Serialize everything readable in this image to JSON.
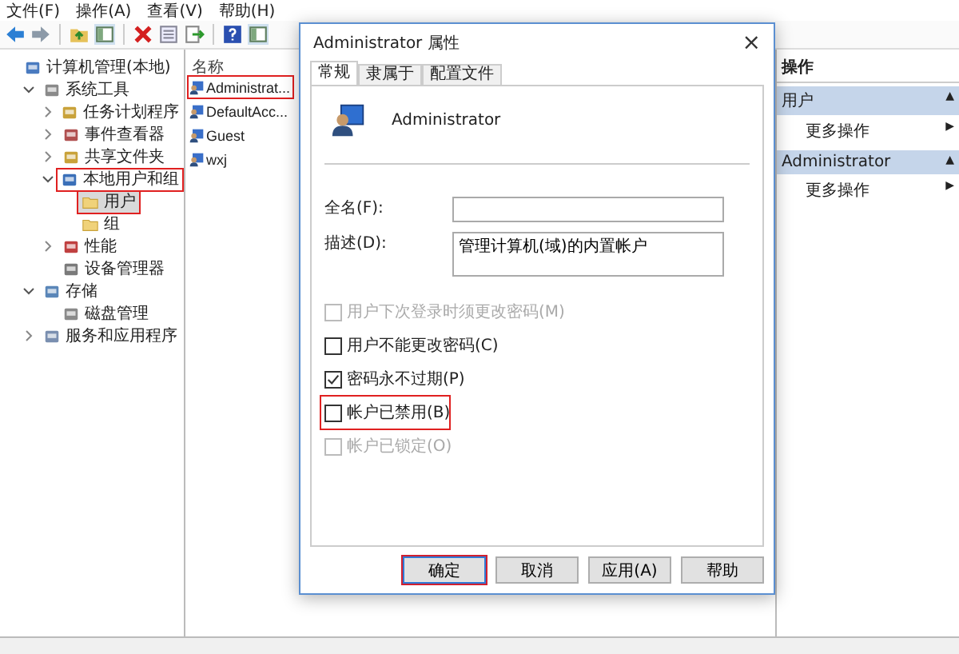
{
  "menu": [
    "文件(F)",
    "操作(A)",
    "查看(V)",
    "帮助(H)"
  ],
  "toolbar": [
    {
      "kind": "back"
    },
    {
      "kind": "forward"
    },
    {
      "kind": "sep"
    },
    {
      "kind": "up"
    },
    {
      "kind": "pane"
    },
    {
      "kind": "sep"
    },
    {
      "kind": "delete"
    },
    {
      "kind": "props"
    },
    {
      "kind": "export"
    },
    {
      "kind": "sep"
    },
    {
      "kind": "help"
    },
    {
      "kind": "pane"
    }
  ],
  "tree": [
    {
      "label": "计算机管理(本地)",
      "kind": "computer",
      "selected": false,
      "highlighted": false,
      "children": [
        {
          "label": "系统工具",
          "kind": "tool",
          "expanded": true,
          "selected": false,
          "highlighted": false,
          "children": [
            {
              "label": "任务计划程序",
              "kind": "clock",
              "expanded": false,
              "selected": false,
              "highlighted": false
            },
            {
              "label": "事件查看器",
              "kind": "log",
              "expanded": false,
              "selected": false,
              "highlighted": false
            },
            {
              "label": "共享文件夹",
              "kind": "share",
              "expanded": false,
              "selected": false,
              "highlighted": false
            },
            {
              "label": "本地用户和组",
              "kind": "users",
              "expanded": true,
              "selected": false,
              "highlighted": true,
              "children": [
                {
                  "label": "用户",
                  "kind": "folder",
                  "selected": true,
                  "highlighted": true
                },
                {
                  "label": "组",
                  "kind": "folder",
                  "selected": false,
                  "highlighted": false
                }
              ]
            },
            {
              "label": "性能",
              "kind": "perf",
              "expanded": false,
              "selected": false,
              "highlighted": false
            },
            {
              "label": "设备管理器",
              "kind": "device",
              "selected": false,
              "highlighted": false
            }
          ]
        },
        {
          "label": "存储",
          "kind": "storage",
          "expanded": true,
          "selected": false,
          "highlighted": false,
          "children": [
            {
              "label": "磁盘管理",
              "kind": "disk",
              "selected": false,
              "highlighted": false
            }
          ]
        },
        {
          "label": "服务和应用程序",
          "kind": "services",
          "expanded": false,
          "selected": false,
          "highlighted": false
        }
      ]
    }
  ],
  "list": {
    "header": "名称",
    "items": [
      {
        "name": "Administrat...",
        "highlighted": true
      },
      {
        "name": "DefaultAcc...",
        "highlighted": false
      },
      {
        "name": "Guest",
        "highlighted": false
      },
      {
        "name": "wxj",
        "highlighted": false
      }
    ]
  },
  "dialog": {
    "title": "Administrator 属性",
    "close": "×",
    "tabs": [
      {
        "label": "常规",
        "selected": true
      },
      {
        "label": "隶属于",
        "selected": false
      },
      {
        "label": "配置文件",
        "selected": false
      }
    ],
    "user_name": "Administrator",
    "fields": [
      {
        "label": "全名(F):",
        "kind": "line"
      },
      {
        "label": "描述(D):",
        "value": "管理计算机(域)的内置帐户",
        "kind": "area"
      }
    ],
    "checkboxes": [
      {
        "label": "用户下次登录时须更改密码(M)",
        "checked": false,
        "disabled": true,
        "highlighted": false
      },
      {
        "label": "用户不能更改密码(C)",
        "checked": false,
        "disabled": false,
        "highlighted": false
      },
      {
        "label": "密码永不过期(P)",
        "checked": true,
        "disabled": false,
        "highlighted": false
      },
      {
        "label": "帐户已禁用(B)",
        "checked": false,
        "disabled": false,
        "highlighted": true
      },
      {
        "label": "帐户已锁定(O)",
        "checked": false,
        "disabled": true,
        "highlighted": false
      }
    ],
    "buttons": [
      {
        "label": "确定",
        "default": true,
        "highlighted": true
      },
      {
        "label": "取消",
        "default": false,
        "highlighted": false
      },
      {
        "label": "应用(A)",
        "default": false,
        "highlighted": false
      },
      {
        "label": "帮助",
        "default": false,
        "highlighted": false
      }
    ]
  },
  "actions": {
    "title": "操作",
    "sections": [
      {
        "label": "用户",
        "toggle": "▲",
        "items": [
          {
            "label": "更多操作",
            "arrow": "▶"
          }
        ]
      },
      {
        "label": "Administrator",
        "toggle": "▲",
        "items": [
          {
            "label": "更多操作",
            "arrow": "▶"
          }
        ]
      }
    ]
  }
}
